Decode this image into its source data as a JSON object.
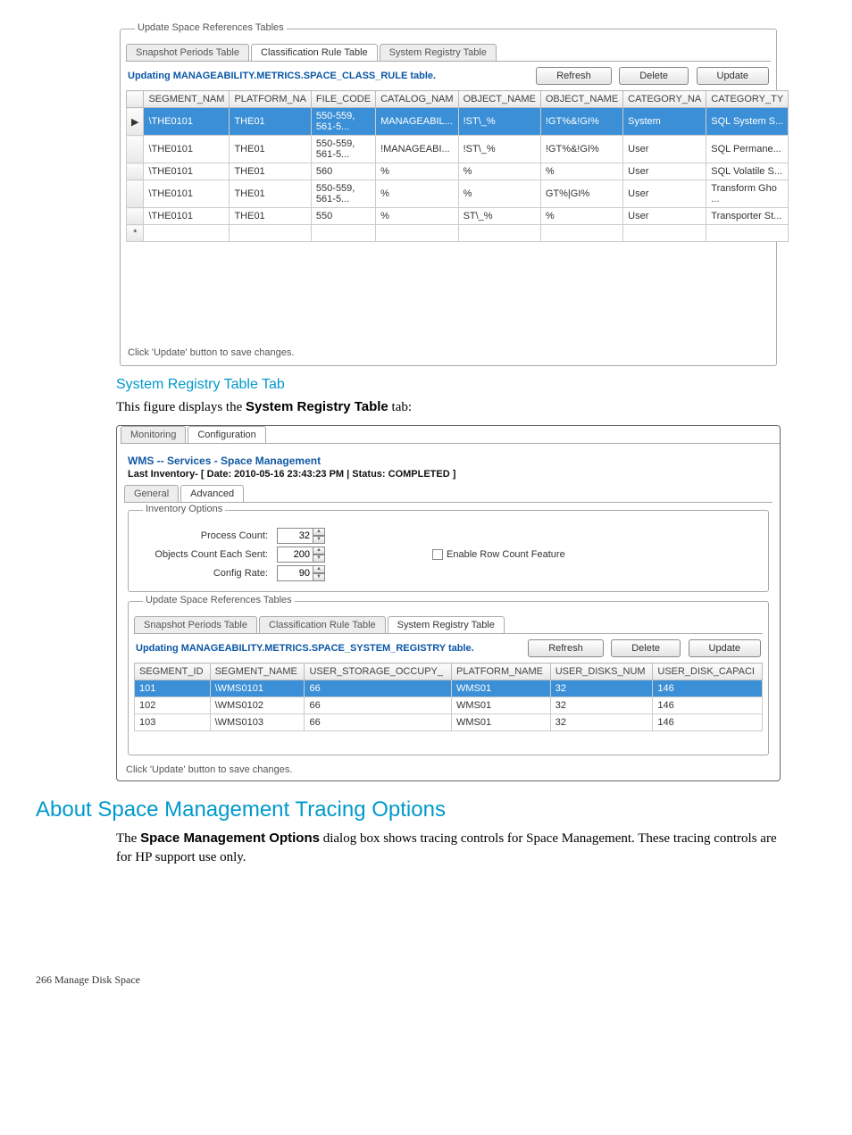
{
  "figure1": {
    "group_label": "Update Space References Tables",
    "tabs": [
      "Snapshot Periods Table",
      "Classification Rule Table",
      "System Registry Table"
    ],
    "active_tab": 1,
    "updating_text": "Updating MANAGEABILITY.METRICS.SPACE_CLASS_RULE table.",
    "buttons": {
      "refresh": "Refresh",
      "delete": "Delete",
      "update": "Update"
    },
    "columns": [
      "SEGMENT_NAM",
      "PLATFORM_NA",
      "FILE_CODE",
      "CATALOG_NAM",
      "OBJECT_NAME",
      "OBJECT_NAME",
      "CATEGORY_NA",
      "CATEGORY_TY"
    ],
    "rowhead_sel": "▶",
    "rowhead_new": "*",
    "rows": [
      [
        "\\THE0101",
        "THE01",
        "550-559, 561-5...",
        "MANAGEABIL...",
        "!ST\\_%",
        "!GT%&!GI%",
        "System",
        "SQL System S..."
      ],
      [
        "\\THE0101",
        "THE01",
        "550-559, 561-5...",
        "!MANAGEABI...",
        "!ST\\_%",
        "!GT%&!GI%",
        "User",
        "SQL Permane..."
      ],
      [
        "\\THE0101",
        "THE01",
        "560",
        "%",
        "%",
        "%",
        "User",
        "SQL Volatile S..."
      ],
      [
        "\\THE0101",
        "THE01",
        "550-559, 561-5...",
        "%",
        "%",
        "GT%|GI%",
        "User",
        "Transform Gho ..."
      ],
      [
        "\\THE0101",
        "THE01",
        "550",
        "%",
        "ST\\_%",
        "%",
        "User",
        "Transporter St..."
      ]
    ],
    "note": "Click 'Update' button to save changes."
  },
  "section1": {
    "heading": "System Registry Table Tab",
    "intro_pre": "This figure displays the ",
    "intro_bold": "System Registry Table",
    "intro_post": " tab:"
  },
  "figure2": {
    "outer_tabs": [
      "Monitoring",
      "Configuration"
    ],
    "outer_active": 1,
    "breadcrumb": "WMS -- Services - Space Management",
    "last_inventory": "Last Inventory- [ Date: 2010-05-16 23:43:23 PM | Status: COMPLETED ]",
    "subtabs": [
      "General",
      "Advanced"
    ],
    "subtab_active": 1,
    "inv_group": "Inventory Options",
    "form": {
      "process_count_label": "Process Count:",
      "process_count": "32",
      "objects_sent_label": "Objects Count Each Sent:",
      "objects_sent": "200",
      "config_rate_label": "Config Rate:",
      "config_rate": "90",
      "checkbox_label": "Enable Row Count Feature"
    },
    "upd_group": "Update Space References Tables",
    "inner_tabs": [
      "Snapshot Periods Table",
      "Classification Rule Table",
      "System Registry Table"
    ],
    "inner_active": 2,
    "updating_text": "Updating MANAGEABILITY.METRICS.SPACE_SYSTEM_REGISTRY table.",
    "buttons": {
      "refresh": "Refresh",
      "delete": "Delete",
      "update": "Update"
    },
    "columns": [
      "SEGMENT_ID",
      "SEGMENT_NAME",
      "USER_STORAGE_OCCUPY_",
      "PLATFORM_NAME",
      "USER_DISKS_NUM",
      "USER_DISK_CAPACI"
    ],
    "rows": [
      [
        "101",
        "\\WMS0101",
        "66",
        "WMS01",
        "32",
        "146"
      ],
      [
        "102",
        "\\WMS0102",
        "66",
        "WMS01",
        "32",
        "146"
      ],
      [
        "103",
        "\\WMS0103",
        "66",
        "WMS01",
        "32",
        "146"
      ]
    ],
    "note": "Click 'Update' button to save changes."
  },
  "section2": {
    "heading": "About Space Management Tracing Options",
    "para_pre": "The ",
    "para_bold": "Space Management Options",
    "para_post": " dialog box shows tracing controls for Space Management. These tracing controls are for HP support use only."
  },
  "footer": "266   Manage Disk Space"
}
